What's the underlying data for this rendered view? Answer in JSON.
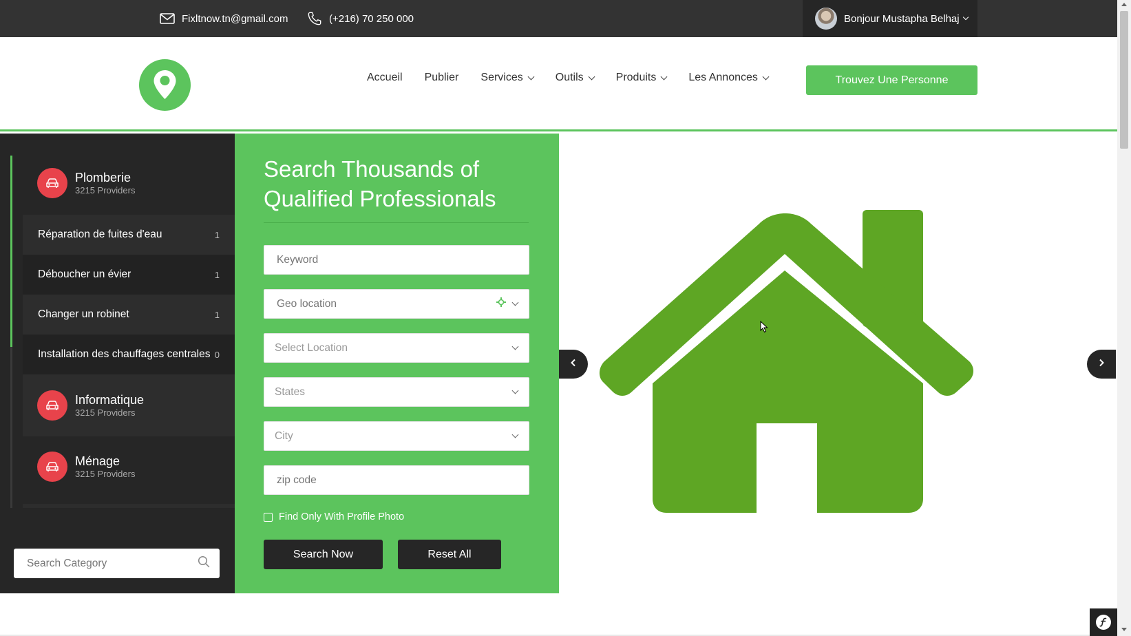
{
  "topbar": {
    "email": "Fixltnow.tn@gmail.com",
    "phone": "(+216) 70 250 000",
    "user_greeting": "Bonjour Mustapha Belhaj"
  },
  "nav": {
    "items": [
      "Accueil",
      "Publier",
      "Services",
      "Outils",
      "Produits",
      "Les Annonces"
    ],
    "cta": "Trouvez Une Personne"
  },
  "sidebar": {
    "categories": [
      {
        "title": "Plomberie",
        "providers": "3215 Providers"
      },
      {
        "title": "Informatique",
        "providers": "3215 Providers"
      },
      {
        "title": "Ménage",
        "providers": "3215 Providers"
      }
    ],
    "sub_items": [
      {
        "label": "Réparation de fuites d'eau",
        "count": "1"
      },
      {
        "label": "Déboucher un évier",
        "count": "1"
      },
      {
        "label": "Changer un robinet",
        "count": "1"
      },
      {
        "label": "Installation des chauffages centrales",
        "count": "0"
      }
    ],
    "search_placeholder": "Search Category"
  },
  "search_panel": {
    "title": "Search Thousands of Qualified Professionals",
    "keyword_placeholder": "Keyword",
    "geo_placeholder": "Geo location",
    "location_select": "Select Location",
    "states_select": "States",
    "city_select": "City",
    "zip_placeholder": "zip code",
    "photo_checkbox": "Find Only With Profile Photo",
    "search_button": "Search Now",
    "reset_button": "Reset All"
  },
  "colors": {
    "brand_green": "#5cc45d",
    "house_green": "#5ea624",
    "dark": "#262626",
    "category_icon": "#e8434b"
  },
  "icons": [
    "envelope-icon",
    "phone-icon",
    "location-pin-logo",
    "car-icon",
    "search-icon",
    "crosshair-icon",
    "house-icon",
    "chevron-left-icon",
    "chevron-right-icon",
    "symfony-icon"
  ]
}
